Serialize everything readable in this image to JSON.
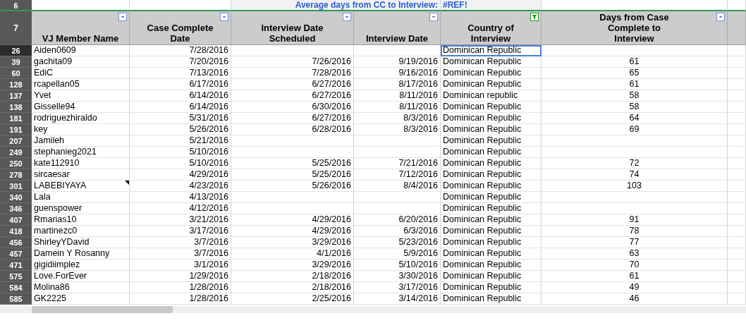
{
  "summary_row": {
    "row": "6",
    "label": "Average days from CC to Interview:",
    "value": "#REF!"
  },
  "header_row": "7",
  "columns": [
    {
      "label": "VJ Member Name",
      "kind": "text",
      "filtered": false
    },
    {
      "label": "Case Complete Date",
      "kind": "date",
      "filtered": false
    },
    {
      "label": "Interview Date Scheduled",
      "kind": "date",
      "filtered": false
    },
    {
      "label": "Interview Date",
      "kind": "date",
      "filtered": false
    },
    {
      "label": "Country of Interview",
      "kind": "text",
      "filtered": true
    },
    {
      "label": "Days from Case Complete to Interview",
      "kind": "number",
      "filtered": false
    }
  ],
  "rows": [
    {
      "row": "26",
      "cells": [
        "Aiden0609",
        "7/28/2016",
        "",
        "",
        "Dominican Republic",
        ""
      ],
      "selected": true,
      "comment": false
    },
    {
      "row": "39",
      "cells": [
        "gachita09",
        "7/20/2016",
        "7/26/2016",
        "9/19/2016",
        "Dominican Republic",
        "61"
      ],
      "selected": false,
      "comment": false
    },
    {
      "row": "60",
      "cells": [
        "EdiC",
        "7/13/2016",
        "7/28/2016",
        "9/16/2016",
        "Dominican Republic",
        "65"
      ],
      "selected": false,
      "comment": false
    },
    {
      "row": "128",
      "cells": [
        "rcapellan05",
        "6/17/2016",
        "6/27/2016",
        "8/17/2016",
        "Dominican Republic",
        "61"
      ],
      "selected": false,
      "comment": false
    },
    {
      "row": "137",
      "cells": [
        "Yvet",
        "6/14/2016",
        "6/27/2016",
        "8/11/2016",
        "Dominican republic",
        "58"
      ],
      "selected": false,
      "comment": false
    },
    {
      "row": "138",
      "cells": [
        "Gisselle94",
        "6/14/2016",
        "6/30/2016",
        "8/11/2016",
        "Dominican Republic",
        "58"
      ],
      "selected": false,
      "comment": false
    },
    {
      "row": "181",
      "cells": [
        "rodriguezhiraldo",
        "5/31/2016",
        "6/27/2016",
        "8/3/2016",
        "Dominican Republic",
        "64"
      ],
      "selected": false,
      "comment": false
    },
    {
      "row": "191",
      "cells": [
        "key",
        "5/26/2016",
        "6/28/2016",
        "8/3/2016",
        "Dominican Republic",
        "69"
      ],
      "selected": false,
      "comment": false
    },
    {
      "row": "207",
      "cells": [
        "Jamileh",
        "5/21/2016",
        "",
        "",
        "Dominican Republic",
        ""
      ],
      "selected": false,
      "comment": false
    },
    {
      "row": "249",
      "cells": [
        "stephanieg2021",
        "5/10/2016",
        "",
        "",
        "Dominican Republic",
        ""
      ],
      "selected": false,
      "comment": false
    },
    {
      "row": "250",
      "cells": [
        "kate112910",
        "5/10/2016",
        "5/25/2016",
        "7/21/2016",
        "Dominican Republic",
        "72"
      ],
      "selected": false,
      "comment": false
    },
    {
      "row": "278",
      "cells": [
        "sircaesar",
        "4/29/2016",
        "5/25/2016",
        "7/12/2016",
        "Dominican Republic",
        "74"
      ],
      "selected": false,
      "comment": false
    },
    {
      "row": "301",
      "cells": [
        "LABEBIYAYA",
        "4/23/2016",
        "5/26/2016",
        "8/4/2016",
        "Dominican Republic",
        "103"
      ],
      "selected": false,
      "comment": true
    },
    {
      "row": "340",
      "cells": [
        "Lala",
        "4/13/2016",
        "",
        "",
        "Dominican Republic",
        ""
      ],
      "selected": false,
      "comment": false
    },
    {
      "row": "346",
      "cells": [
        "guenspower",
        "4/12/2016",
        "",
        "",
        "Dominican Republic",
        ""
      ],
      "selected": false,
      "comment": false
    },
    {
      "row": "407",
      "cells": [
        "Rmarias10",
        "3/21/2016",
        "4/29/2016",
        "6/20/2016",
        "Dominican Republic",
        "91"
      ],
      "selected": false,
      "comment": false
    },
    {
      "row": "418",
      "cells": [
        "martinezc0",
        "3/17/2016",
        "4/29/2016",
        "6/3/2016",
        "Dominican Republic",
        "78"
      ],
      "selected": false,
      "comment": false
    },
    {
      "row": "456",
      "cells": [
        "ShirleyYDavid",
        "3/7/2016",
        "3/29/2016",
        "5/23/2016",
        "Dominican Republic",
        "77"
      ],
      "selected": false,
      "comment": false
    },
    {
      "row": "457",
      "cells": [
        "Damein Y Rosanny",
        "3/7/2016",
        "4/1/2016",
        "5/9/2016",
        "Dominican Republic",
        "63"
      ],
      "selected": false,
      "comment": false
    },
    {
      "row": "471",
      "cells": [
        "gigidiimplez",
        "3/1/2016",
        "3/29/2016",
        "5/10/2016",
        "Dominican Republic",
        "70"
      ],
      "selected": false,
      "comment": false
    },
    {
      "row": "575",
      "cells": [
        "Love.ForEver",
        "1/29/2016",
        "2/18/2016",
        "3/30/2016",
        "Dominican Republic",
        "61"
      ],
      "selected": false,
      "comment": false
    },
    {
      "row": "584",
      "cells": [
        "Molina86",
        "1/28/2016",
        "2/18/2016",
        "3/17/2016",
        "Dominican Republic",
        "49"
      ],
      "selected": false,
      "comment": false
    },
    {
      "row": "585",
      "cells": [
        "GK2225",
        "1/28/2016",
        "2/25/2016",
        "3/14/2016",
        "Dominican Republic",
        "46"
      ],
      "selected": false,
      "comment": false
    }
  ]
}
